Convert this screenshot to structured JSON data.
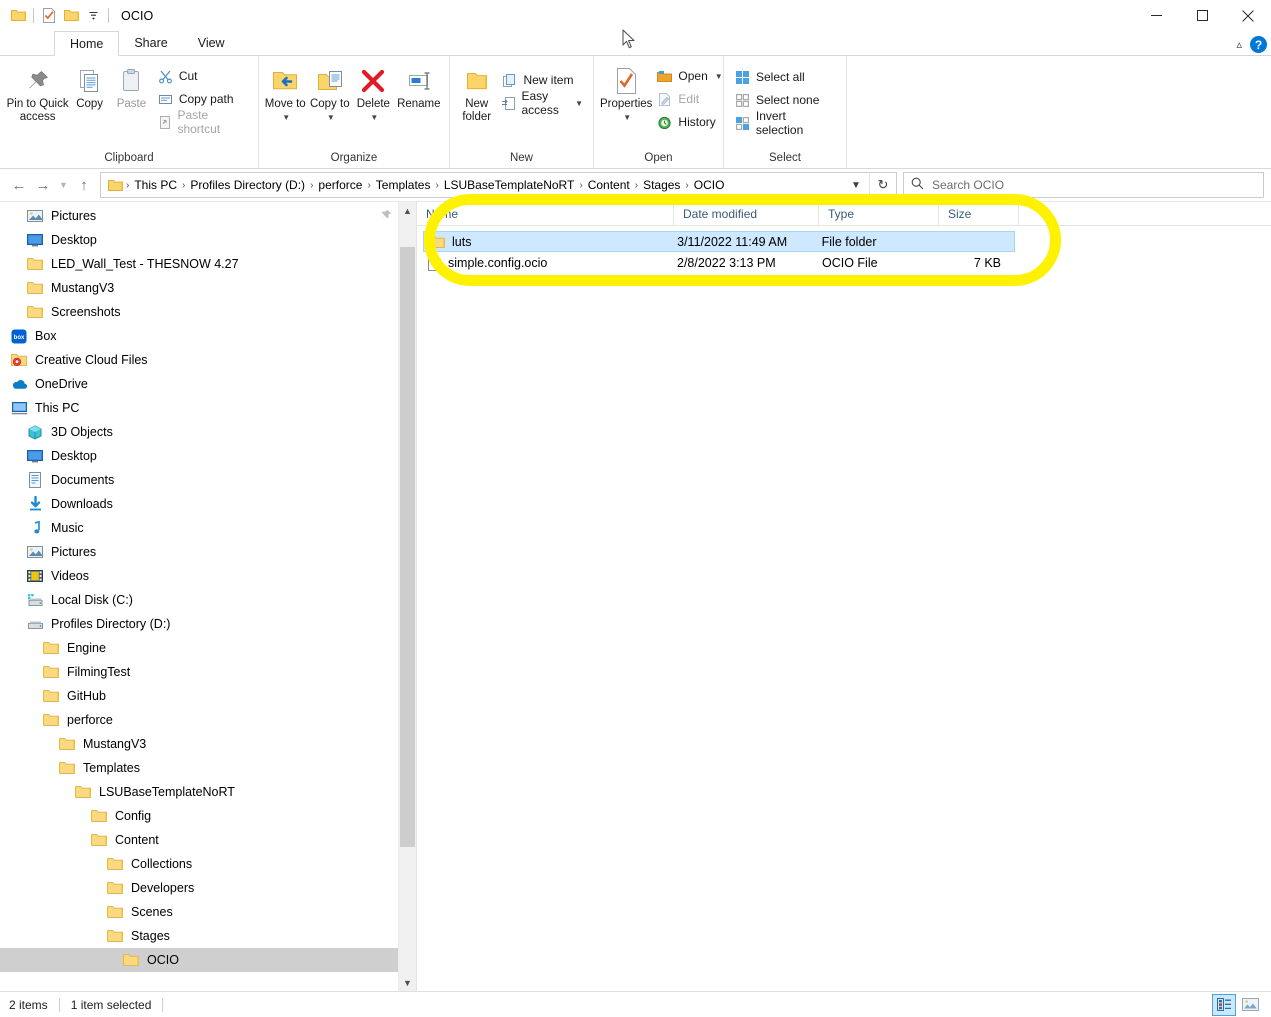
{
  "window": {
    "title": "OCIO",
    "quick_access_icons": [
      "folder-icon",
      "properties-check-icon",
      "new-folder-icon",
      "customize-qat-chevron-icon"
    ],
    "caption_buttons": [
      {
        "name": "minimize",
        "glyph": "minimize-icon"
      },
      {
        "name": "maximize",
        "glyph": "maximize-icon"
      },
      {
        "name": "close",
        "glyph": "close-icon"
      }
    ]
  },
  "tabs": [
    {
      "label": "Home",
      "active": true
    },
    {
      "label": "Share",
      "active": false
    },
    {
      "label": "View",
      "active": false
    }
  ],
  "ribbon": {
    "collapse_label": "^",
    "help_label": "?",
    "groups": [
      {
        "label": "Clipboard",
        "big_buttons": [
          {
            "label": "Pin to Quick access",
            "icon": "pin-icon",
            "disabled": false
          },
          {
            "label": "Copy",
            "icon": "copy-icon",
            "disabled": false
          },
          {
            "label": "Paste",
            "icon": "paste-icon",
            "disabled": true
          }
        ],
        "small_buttons": [
          {
            "label": "Cut",
            "icon": "scissors-icon",
            "disabled": false
          },
          {
            "label": "Copy path",
            "icon": "copy-path-icon",
            "disabled": false
          },
          {
            "label": "Paste shortcut",
            "icon": "paste-shortcut-icon",
            "disabled": true
          }
        ]
      },
      {
        "label": "Organize",
        "big_buttons": [
          {
            "label": "Move to",
            "icon": "move-to-icon",
            "dropdown": true
          },
          {
            "label": "Copy to",
            "icon": "copy-to-icon",
            "dropdown": true
          },
          {
            "label": "Delete",
            "icon": "delete-x-icon",
            "dropdown": true
          },
          {
            "label": "Rename",
            "icon": "rename-icon",
            "dropdown": false
          }
        ]
      },
      {
        "label": "New",
        "big_buttons": [
          {
            "label": "New folder",
            "icon": "new-folder-icon"
          }
        ],
        "small_buttons": [
          {
            "label": "New item",
            "icon": "new-item-icon",
            "dropdown": false
          },
          {
            "label": "Easy access",
            "icon": "easy-access-icon",
            "dropdown": true
          }
        ]
      },
      {
        "label": "Open",
        "big_buttons": [
          {
            "label": "Properties",
            "icon": "properties-icon",
            "dropdown": true
          }
        ],
        "small_buttons": [
          {
            "label": "Open",
            "icon": "open-folder-icon",
            "dropdown": true,
            "disabled": false
          },
          {
            "label": "Edit",
            "icon": "edit-icon",
            "disabled": true
          },
          {
            "label": "History",
            "icon": "history-icon",
            "disabled": false
          }
        ]
      },
      {
        "label": "Select",
        "small_buttons": [
          {
            "label": "Select all",
            "icon": "select-all-icon"
          },
          {
            "label": "Select none",
            "icon": "select-none-icon"
          },
          {
            "label": "Invert selection",
            "icon": "invert-selection-icon"
          }
        ]
      }
    ]
  },
  "address": {
    "back_tooltip": "Back",
    "forward_tooltip": "Forward",
    "recent_tooltip": "Recent locations",
    "up_tooltip": "Up",
    "crumbs": [
      "This PC",
      "Profiles Directory (D:)",
      "perforce",
      "Templates",
      "LSUBaseTemplateNoRT",
      "Content",
      "Stages",
      "OCIO"
    ],
    "separator": "›",
    "dropdown_glyph": "chevron-down-icon",
    "refresh_glyph": "refresh-icon"
  },
  "search": {
    "placeholder": "Search OCIO",
    "value": ""
  },
  "navpane": {
    "items": [
      {
        "label": "Pictures",
        "icon": "pictures-icon",
        "indent": 1,
        "pinned": true,
        "selected": false
      },
      {
        "label": "Desktop",
        "icon": "desktop-icon",
        "indent": 1,
        "selected": false
      },
      {
        "label": "LED_Wall_Test - THESNOW 4.27",
        "icon": "folder-icon",
        "indent": 1,
        "selected": false
      },
      {
        "label": "MustangV3",
        "icon": "folder-icon",
        "indent": 1,
        "selected": false
      },
      {
        "label": "Screenshots",
        "icon": "folder-icon",
        "indent": 1,
        "selected": false
      },
      {
        "label": "Box",
        "icon": "box-icon",
        "indent": 0,
        "selected": false
      },
      {
        "label": "Creative Cloud Files",
        "icon": "creative-cloud-icon",
        "indent": 0,
        "selected": false
      },
      {
        "label": "OneDrive",
        "icon": "onedrive-icon",
        "indent": 0,
        "selected": false
      },
      {
        "label": "This PC",
        "icon": "this-pc-icon",
        "indent": 0,
        "selected": false
      },
      {
        "label": "3D Objects",
        "icon": "3d-objects-icon",
        "indent": 1,
        "selected": false
      },
      {
        "label": "Desktop",
        "icon": "desktop-icon",
        "indent": 1,
        "selected": false
      },
      {
        "label": "Documents",
        "icon": "documents-icon",
        "indent": 1,
        "selected": false
      },
      {
        "label": "Downloads",
        "icon": "downloads-icon",
        "indent": 1,
        "selected": false
      },
      {
        "label": "Music",
        "icon": "music-icon",
        "indent": 1,
        "selected": false
      },
      {
        "label": "Pictures",
        "icon": "pictures-icon",
        "indent": 1,
        "selected": false
      },
      {
        "label": "Videos",
        "icon": "videos-icon",
        "indent": 1,
        "selected": false
      },
      {
        "label": "Local Disk (C:)",
        "icon": "local-disk-icon",
        "indent": 1,
        "selected": false
      },
      {
        "label": "Profiles Directory (D:)",
        "icon": "drive-icon",
        "indent": 1,
        "selected": false
      },
      {
        "label": "Engine",
        "icon": "folder-icon",
        "indent": 2,
        "selected": false
      },
      {
        "label": "FilmingTest",
        "icon": "folder-icon",
        "indent": 2,
        "selected": false
      },
      {
        "label": "GitHub",
        "icon": "folder-icon",
        "indent": 2,
        "selected": false
      },
      {
        "label": "perforce",
        "icon": "folder-icon",
        "indent": 2,
        "selected": false
      },
      {
        "label": "MustangV3",
        "icon": "folder-icon",
        "indent": 3,
        "selected": false
      },
      {
        "label": "Templates",
        "icon": "folder-icon",
        "indent": 3,
        "selected": false
      },
      {
        "label": "LSUBaseTemplateNoRT",
        "icon": "folder-icon",
        "indent": 4,
        "selected": false
      },
      {
        "label": "Config",
        "icon": "folder-icon",
        "indent": 5,
        "selected": false
      },
      {
        "label": "Content",
        "icon": "folder-icon",
        "indent": 5,
        "selected": false
      },
      {
        "label": "Collections",
        "icon": "folder-icon",
        "indent": 6,
        "selected": false
      },
      {
        "label": "Developers",
        "icon": "folder-icon",
        "indent": 6,
        "selected": false
      },
      {
        "label": "Scenes",
        "icon": "folder-icon",
        "indent": 6,
        "selected": false
      },
      {
        "label": "Stages",
        "icon": "folder-icon",
        "indent": 6,
        "selected": false
      },
      {
        "label": "OCIO",
        "icon": "folder-icon",
        "indent": 7,
        "selected": true
      }
    ]
  },
  "filelist": {
    "columns": [
      {
        "label": "Name"
      },
      {
        "label": "Date modified"
      },
      {
        "label": "Type"
      },
      {
        "label": "Size"
      }
    ],
    "rows": [
      {
        "name": "luts",
        "date_modified": "3/11/2022 11:49 AM",
        "type": "File folder",
        "size": "",
        "icon": "folder-icon",
        "selected": true
      },
      {
        "name": "simple.config.ocio",
        "date_modified": "2/8/2022 3:13 PM",
        "type": "OCIO File",
        "size": "7 KB",
        "icon": "generic-file-icon",
        "selected": false
      }
    ]
  },
  "statusbar": {
    "item_count": "2 items",
    "selection": "1 item selected",
    "view_buttons": [
      {
        "name": "details-view",
        "active": true
      },
      {
        "name": "large-icons-view",
        "active": false
      }
    ]
  },
  "annotation": {
    "shape": "ellipse-highlight",
    "color": "#fff200"
  }
}
